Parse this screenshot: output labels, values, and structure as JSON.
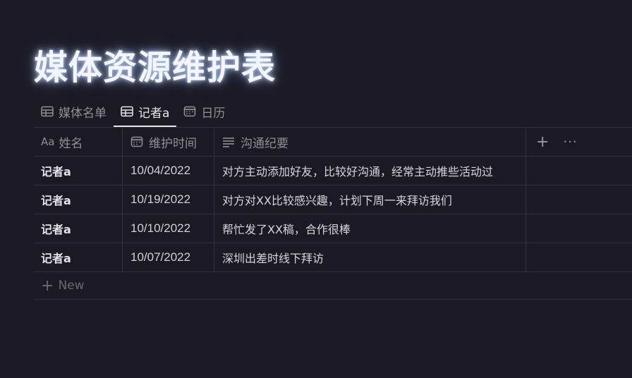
{
  "page": {
    "title": "媒体资源维护表"
  },
  "tabs": [
    {
      "label": "媒体名单",
      "icon": "table-icon",
      "active": false
    },
    {
      "label": "记者a",
      "icon": "table-icon",
      "active": true
    },
    {
      "label": "日历",
      "icon": "calendar-icon",
      "active": false
    }
  ],
  "table": {
    "columns": {
      "name": {
        "label": "姓名",
        "icon": "Aa"
      },
      "date": {
        "label": "维护时间",
        "icon": "calendar-icon"
      },
      "notes": {
        "label": "沟通纪要",
        "icon": "text-lines-icon"
      }
    },
    "add_column": "+",
    "more": "···",
    "rows": [
      {
        "name": "记者a",
        "date": "10/04/2022",
        "notes": "对方主动添加好友，比较好沟通，经常主动推些活动过"
      },
      {
        "name": "记者a",
        "date": "10/19/2022",
        "notes": "对方对XX比较感兴趣，计划下周一来拜访我们"
      },
      {
        "name": "记者a",
        "date": "10/10/2022",
        "notes": "帮忙发了XX稿，合作很棒"
      },
      {
        "name": "记者a",
        "date": "10/07/2022",
        "notes": "深圳出差时线下拜访"
      }
    ],
    "new_label": "New",
    "new_icon": "+"
  },
  "colors": {
    "background": "#1b1a24",
    "border": "#34333d",
    "muted_text": "#8f8f96",
    "title_glow": "#bed7ff"
  }
}
